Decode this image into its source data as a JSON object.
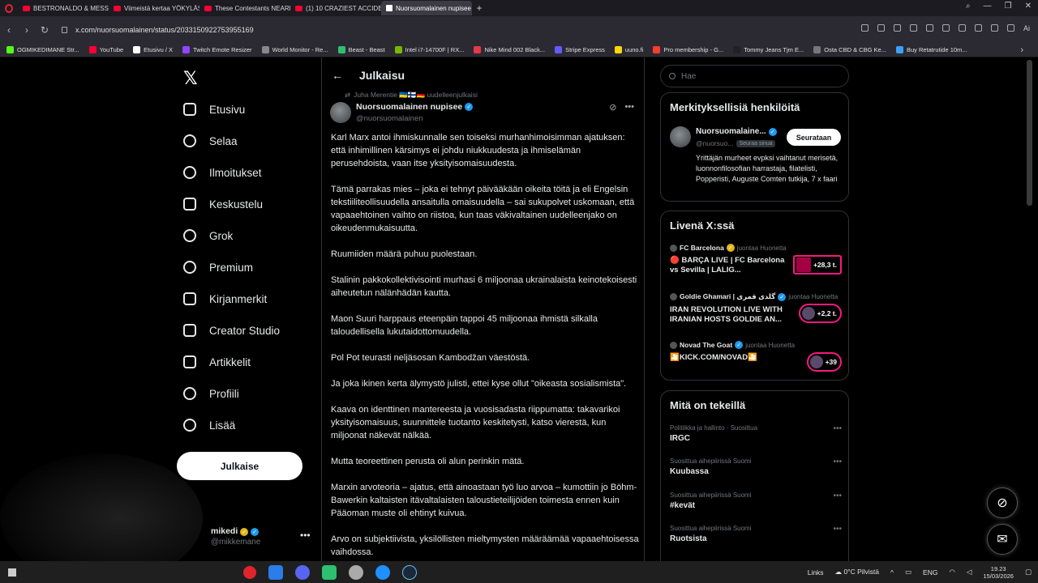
{
  "browser": {
    "tabs": [
      {
        "label": "BESTRONALDO & MESSI"
      },
      {
        "label": "Viimeistä kertaa YÖKYLÄS"
      },
      {
        "label": "These Contestants NEARL"
      },
      {
        "label": "(1) 10 CRAZIEST ACCIDEN"
      },
      {
        "label": "Nuorsuomalainen nupisee",
        "active": true
      }
    ],
    "url": "x.com/nuorsuomalainen/status/2033150922753955169",
    "ai_label": "Ai",
    "bookmarks": [
      {
        "label": "OGMIKEDIMANE Str...",
        "color": "#53fc18"
      },
      {
        "label": "YouTube",
        "color": "#ff0033"
      },
      {
        "label": "Etusivu / X",
        "color": "#ffffff"
      },
      {
        "label": "Twitch Emote Resizer",
        "color": "#9146ff"
      },
      {
        "label": "World Monitor - Re...",
        "color": "#888888"
      },
      {
        "label": "Beast - Beast",
        "color": "#2fbf71"
      },
      {
        "label": "Intel i7-14700F | RX...",
        "color": "#76b900"
      },
      {
        "label": "Nike Mind 002 Black...",
        "color": "#e63946"
      },
      {
        "label": "Stripe Express",
        "color": "#635bff"
      },
      {
        "label": "uuno.fi",
        "color": "#ffd60a"
      },
      {
        "label": "Pro membership - G...",
        "color": "#ff3b30"
      },
      {
        "label": "Tommy Jeans Tjm E...",
        "color": "#222222"
      },
      {
        "label": "Osta CBD & CBG Ke...",
        "color": "#777777"
      },
      {
        "label": "Buy Retatrutide 10m...",
        "color": "#3aa0ff"
      }
    ]
  },
  "nav": {
    "items": [
      {
        "label": "Etusivu",
        "icon": "home-icon"
      },
      {
        "label": "Selaa",
        "icon": "search-icon"
      },
      {
        "label": "Ilmoitukset",
        "icon": "bell-icon"
      },
      {
        "label": "Keskustelu",
        "icon": "mail-icon"
      },
      {
        "label": "Grok",
        "icon": "grok-icon"
      },
      {
        "label": "Premium",
        "icon": "premium-icon"
      },
      {
        "label": "Kirjanmerkit",
        "icon": "bookmark-icon"
      },
      {
        "label": "Creator Studio",
        "icon": "rocket-icon"
      },
      {
        "label": "Artikkelit",
        "icon": "article-icon"
      },
      {
        "label": "Profiili",
        "icon": "profile-icon"
      },
      {
        "label": "Lisää",
        "icon": "more-icon"
      }
    ],
    "post_button": "Julkaise",
    "account": {
      "name": "mikedi",
      "handle": "@mikkemane"
    }
  },
  "post": {
    "header_title": "Julkaisu",
    "repost_by": "Juha Merentie 🇺🇦🇫🇮🇩🇪 uudelleenjulkaisi",
    "author_name": "Nuorsuomalainen nupisee",
    "author_handle": "@nuorsuomalainen",
    "paragraphs": [
      "Karl Marx antoi ihmiskunnalle sen toiseksi murhanhimoisimman ajatuksen: että inhimillinen kärsimys ei johdu niukkuudesta ja ihmiselämän perusehdoista, vaan itse yksityisomaisuudesta.",
      "Tämä parrakas mies – joka ei tehnyt päivääkään oikeita töitä ja eli Engelsin tekstiiliteollisuudella ansaitulla omaisuudella – sai sukupolvet uskomaan, että vapaaehtoinen vaihto on riistoa, kun taas väkivaltainen uudelleenjako on oikeudenmukaisuutta.",
      "Ruumiiden määrä puhuu puolestaan.",
      "Stalinin pakkokollektivisointi murhasi 6 miljoonaa ukrainalaista keinotekoisesti aiheutetun nälänhädän kautta.",
      "Maon Suuri harppaus eteenpäin tappoi 45 miljoonaa ihmistä silkalla taloudellisella lukutaidottomuudella.",
      "Pol Pot teurasti neljäsosan Kambodžan väestöstä.",
      "Ja joka ikinen kerta älymystö julisti, ettei kyse ollut \"oikeasta sosialismista\".",
      "Kaava on identtinen mantereesta ja vuosisadasta riippumatta: takavarikoi yksityisomaisuus, suunnittele tuotanto keskitetysti, katso vierestä, kun miljoonat näkevät nälkää.",
      "Mutta teoreettinen perusta oli alun perinkin mätä.",
      "Marxin arvoteoria – ajatus, että ainoastaan työ luo arvoa – kumottiin jo Böhm-Bawerkin kaltaisten itävaltalaisten taloustieteilijöiden toimesta ennen kuin Pääoman muste oli ehtinyt kuivua.",
      "Arvo on subjektiivista, yksilöllisten mieltymysten määräämää vapaaehtoisessa vaihdossa."
    ]
  },
  "sidebar": {
    "search_placeholder": "Hae",
    "relevant": {
      "title": "Merkityksellisiä henkilöitä",
      "name": "Nuorsuomalaine...",
      "handle": "@nuorsuo...",
      "follows_you": "Seuraa sinua",
      "follow_button": "Seurataan",
      "bio": "Yrittäjän murheet evpksi vaihtanut merisetä, luonnonfilosofian harrastaja, filatelisti, Popperisti, Auguste Comten tutkija, 7 x faari"
    },
    "live": {
      "title": "Livenä X:ssä",
      "items": [
        {
          "host": "FC Barcelona",
          "role": "juontaa Huonetta",
          "title": "🔴 BARÇA LIVE | FC Barcelona vs Sevilla | LALIG...",
          "count": "+28,3 t."
        },
        {
          "host": "Goldie Ghamari | گلدی قمری",
          "role": "juontaa Huonetta",
          "title": "IRAN REVOLUTION LIVE WITH IRANIAN HOSTS GOLDIE AN...",
          "count": "+2,2 t."
        },
        {
          "host": "Novad The Goat",
          "role": "juontaa Huonetta",
          "title": "🎦KICK.COM/NOVAD🎦",
          "count": "+39"
        }
      ]
    },
    "trends": {
      "title": "Mitä on tekeillä",
      "items": [
        {
          "category": "Politiikka ja hallinto · Suosittua",
          "name": "IRGC"
        },
        {
          "category": "Suosittua aihepiirissä Suomi",
          "name": "Kuubassa"
        },
        {
          "category": "Suosittua aihepiirissä Suomi",
          "name": "#kevät"
        },
        {
          "category": "Suosittua aihepiirissä Suomi",
          "name": "Ruotsista"
        }
      ]
    }
  },
  "taskbar": {
    "links_label": "Links",
    "weather": "0°C  Pilvistä",
    "language": "ENG",
    "time": "19.23",
    "date": "15/03/2026"
  }
}
